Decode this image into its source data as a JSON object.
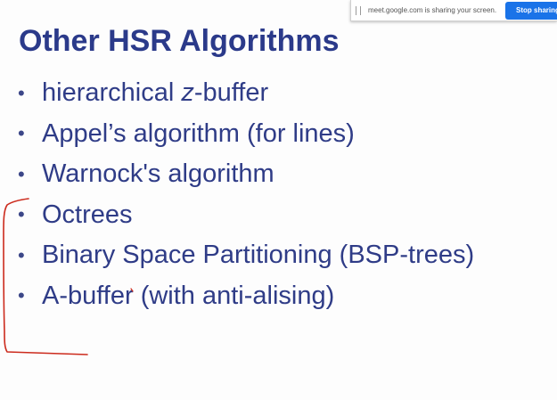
{
  "slide": {
    "title": "Other HSR Algorithms",
    "bullets": [
      {
        "parts": [
          {
            "text": "hierarchical "
          },
          {
            "text": "z",
            "italic": true
          },
          {
            "text": "-buffer"
          }
        ]
      },
      {
        "parts": [
          {
            "text": "Appel’s algorithm (for lines)"
          }
        ]
      },
      {
        "parts": [
          {
            "text": "Warnock's algorithm"
          }
        ]
      },
      {
        "parts": [
          {
            "text": "Octrees"
          }
        ]
      },
      {
        "parts": [
          {
            "text": "Binary Space Partitioning (BSP-trees)"
          }
        ]
      },
      {
        "parts": [
          {
            "text": "A-buffer (with anti-alising)"
          }
        ]
      }
    ],
    "bullet_glyph": "•"
  },
  "share_bar": {
    "message": "meet.google.com is sharing your screen.",
    "stop_label": "Stop sharing"
  },
  "annotation": {
    "color": "#cc2b1d"
  },
  "colors": {
    "title": "#2b3a8a",
    "text": "#2f3c87",
    "stop_button": "#1a73e8"
  }
}
